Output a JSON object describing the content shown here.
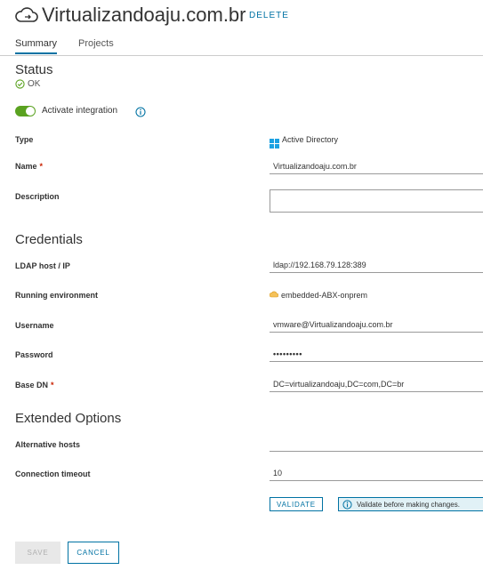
{
  "header": {
    "title": "Virtualizandoaju.com.br",
    "delete_label": "DELETE",
    "icon": "cloud-sync-icon"
  },
  "tabs": [
    {
      "label": "Summary",
      "active": true
    },
    {
      "label": "Projects",
      "active": false
    }
  ],
  "status": {
    "heading": "Status",
    "value": "OK",
    "icon": "check-circle-icon",
    "color": "#5aa220"
  },
  "integration": {
    "toggle_label": "Activate integration",
    "enabled": true,
    "info_icon": "info-icon"
  },
  "fields": {
    "type": {
      "label": "Type",
      "value": "Active Directory",
      "icon": "windows-icon"
    },
    "name": {
      "label": "Name",
      "required_mark": "*",
      "value": "Virtualizandoaju.com.br"
    },
    "description": {
      "label": "Description",
      "value": ""
    }
  },
  "credentials": {
    "heading": "Credentials",
    "ldap_host": {
      "label": "LDAP host / IP",
      "value": "ldap://192.168.79.128:389"
    },
    "running_env": {
      "label": "Running environment",
      "value": "embedded-ABX-onprem",
      "icon": "cloud-env-icon"
    },
    "username": {
      "label": "Username",
      "value": "vmware@Virtualizandoaju.com.br"
    },
    "password": {
      "label": "Password",
      "value": "•••••••••"
    },
    "base_dn": {
      "label": "Base DN",
      "required_mark": "*",
      "value": "DC=virtualizandoaju,DC=com,DC=br"
    }
  },
  "extended": {
    "heading": "Extended Options",
    "alt_hosts": {
      "label": "Alternative hosts",
      "value": ""
    },
    "timeout": {
      "label": "Connection timeout",
      "value": "10"
    }
  },
  "validate": {
    "button_label": "VALIDATE",
    "hint": "Validate before making changes.",
    "hint_icon": "info-icon"
  },
  "footer": {
    "save_label": "SAVE",
    "cancel_label": "CANCEL"
  },
  "colors": {
    "accent": "#0072a3",
    "success": "#5aa220",
    "required": "#c92100"
  }
}
